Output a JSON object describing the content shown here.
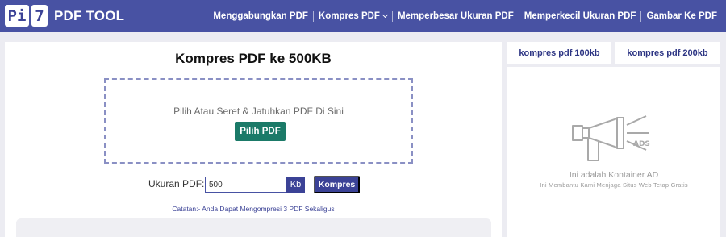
{
  "header": {
    "logo_left": "Pi",
    "logo_right": "7",
    "logo_text": "PDF TOOL",
    "nav": [
      {
        "label": "Menggabungkan PDF"
      },
      {
        "label": "Kompres PDF"
      },
      {
        "label": "Memperbesar Ukuran PDF"
      },
      {
        "label": "Memperkecil Ukuran PDF"
      },
      {
        "label": "Gambar Ke PDF"
      }
    ]
  },
  "main": {
    "title": "Kompres PDF ke 500KB",
    "drop_text": "Pilih Atau Seret & Jatuhkan PDF Di Sini",
    "pick_button": "Pilih PDF",
    "size_label": "Ukuran PDF:",
    "size_value": "500",
    "unit": "Kb",
    "compress_button": "Kompres",
    "note": "Catatan:- Anda Dapat Mengompresi 3 PDF Sekaligus"
  },
  "sidebar": {
    "tabs": [
      {
        "label": "kompres pdf 100kb"
      },
      {
        "label": "kompres pdf 200kb"
      }
    ],
    "ad": {
      "icon_text": "ADS",
      "title": "Ini adalah Kontainer AD",
      "subtitle": "Ini Membantu Kami Menjaga Situs Web Tetap Gratis"
    }
  },
  "colors": {
    "header_bg": "#4852a3",
    "primary": "#3b4296",
    "pick_button_bg": "#1b7a68",
    "page_bg": "#ececf2"
  }
}
